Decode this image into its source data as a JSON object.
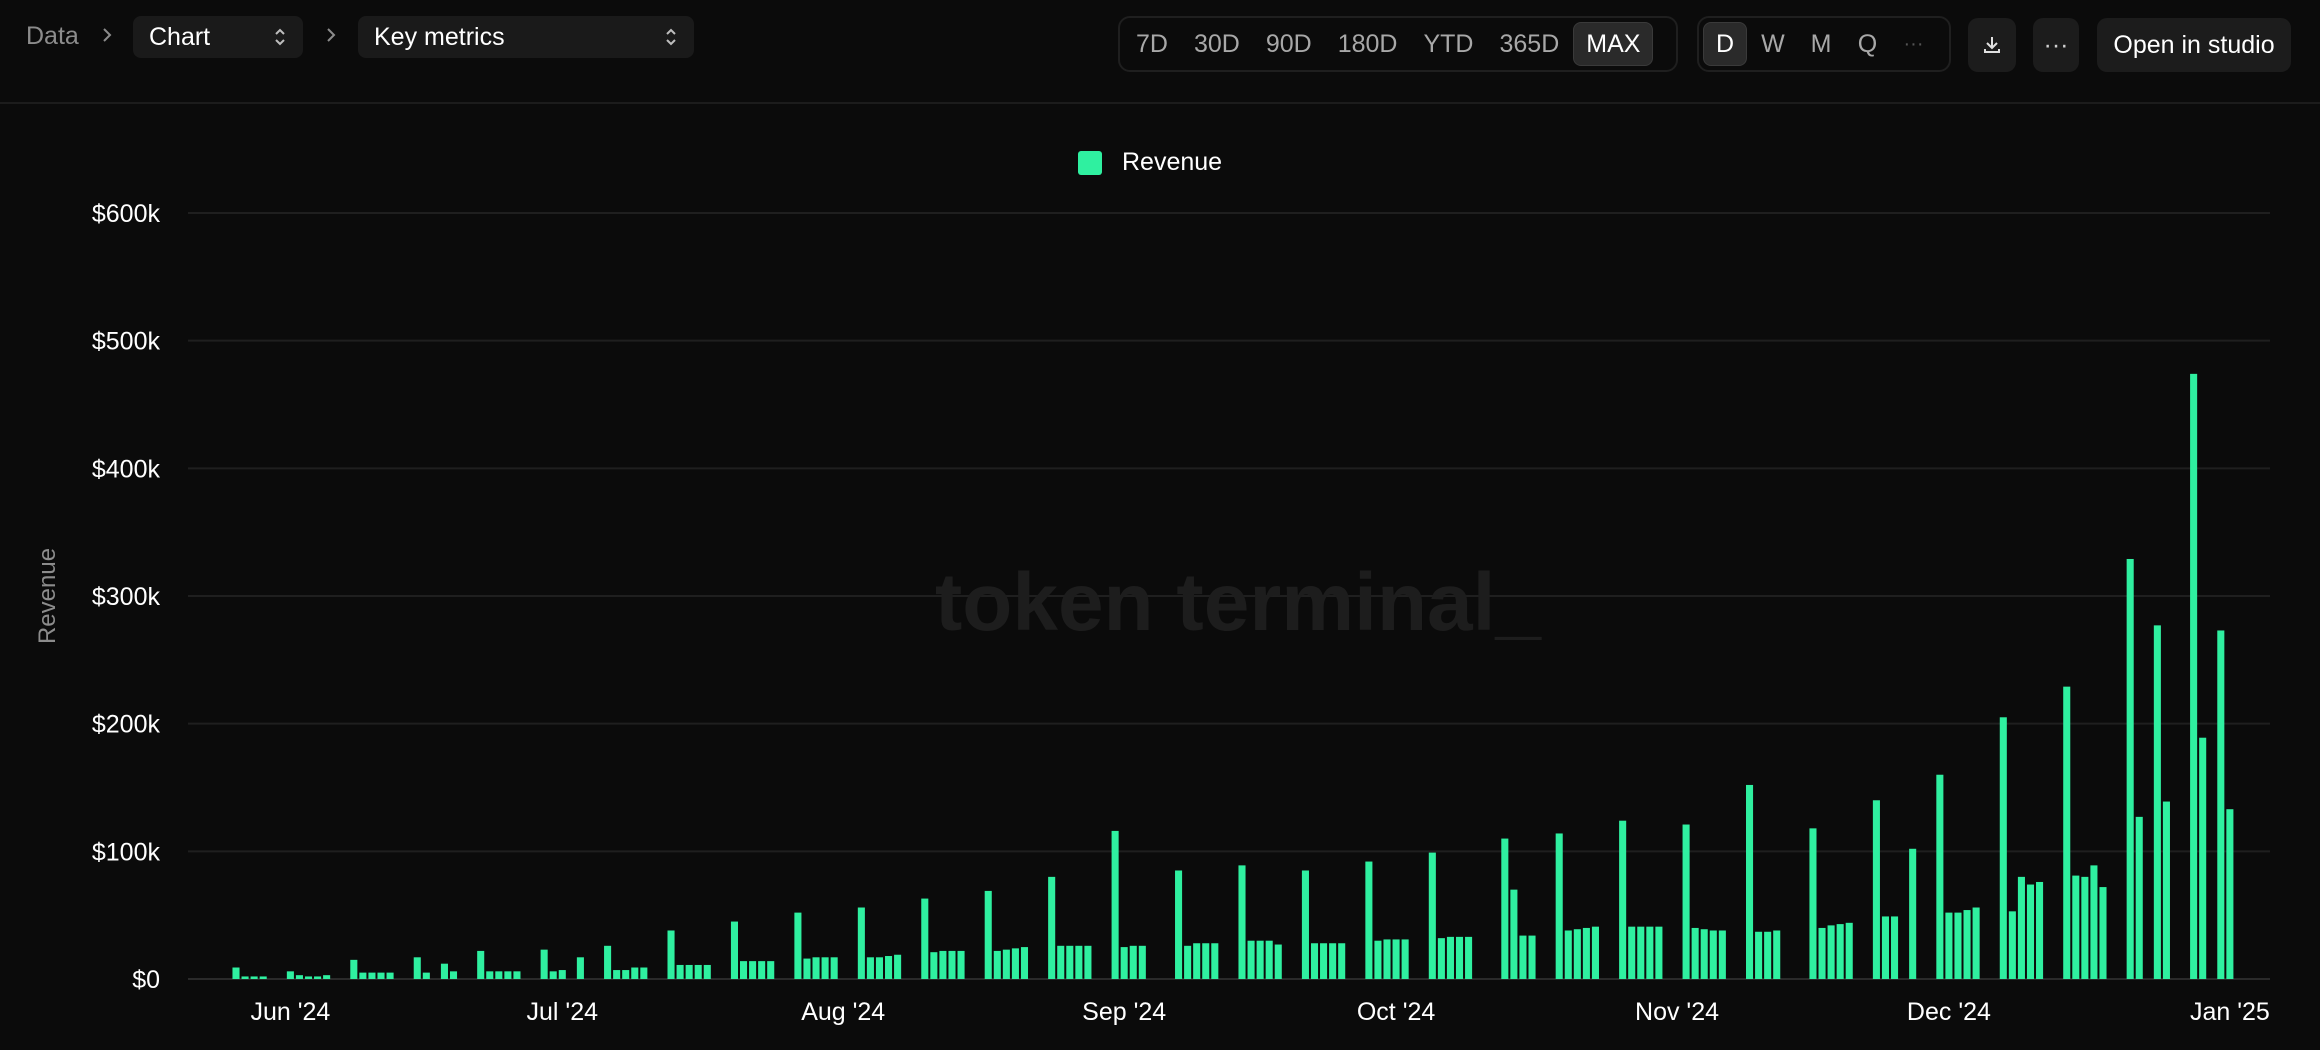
{
  "breadcrumb": {
    "root": "Data",
    "view": "Chart",
    "metric": "Key metrics"
  },
  "toolbar": {
    "ranges": [
      "7D",
      "30D",
      "90D",
      "180D",
      "YTD",
      "365D",
      "MAX"
    ],
    "active_range": "MAX",
    "granularity": [
      "D",
      "W",
      "M",
      "Q"
    ],
    "active_granularity": "D",
    "more_label": "···",
    "download_icon": "download-icon",
    "open_label": "Open in studio"
  },
  "watermark": "token terminal_",
  "colors": {
    "bar": "#2ff0a0",
    "background": "#0b0b0b",
    "grid": "#1f1f1f"
  },
  "chart_data": {
    "type": "bar",
    "series": [
      {
        "name": "Revenue"
      }
    ],
    "ylabel": "Revenue",
    "xlabel": "",
    "ylim": [
      0,
      600000
    ],
    "yticks": [
      0,
      100000,
      200000,
      300000,
      400000,
      500000,
      600000
    ],
    "ytick_labels": [
      "$0",
      "$100k",
      "$200k",
      "$300k",
      "$400k",
      "$500k",
      "$600k"
    ],
    "xticks": [
      "2024-06-01",
      "2024-07-01",
      "2024-08-01",
      "2024-09-01",
      "2024-10-01",
      "2024-11-01",
      "2024-12-01",
      "2025-01-01"
    ],
    "xtick_labels": [
      "Jun '24",
      "Jul '24",
      "Aug '24",
      "Sep '24",
      "Oct '24",
      "Nov '24",
      "Dec '24",
      "Jan '25"
    ],
    "x_range": [
      "2024-05-26",
      "2025-01-03"
    ],
    "legend": "top-center",
    "grid": true,
    "points": [
      [
        "2024-05-26",
        9000
      ],
      [
        "2024-05-27",
        2000
      ],
      [
        "2024-05-28",
        2000
      ],
      [
        "2024-05-29",
        2000
      ],
      [
        "2024-06-01",
        6000
      ],
      [
        "2024-06-02",
        3000
      ],
      [
        "2024-06-03",
        2000
      ],
      [
        "2024-06-04",
        2000
      ],
      [
        "2024-06-05",
        3000
      ],
      [
        "2024-06-08",
        15000
      ],
      [
        "2024-06-09",
        5000
      ],
      [
        "2024-06-10",
        5000
      ],
      [
        "2024-06-11",
        5000
      ],
      [
        "2024-06-12",
        5000
      ],
      [
        "2024-06-15",
        17000
      ],
      [
        "2024-06-16",
        5000
      ],
      [
        "2024-06-18",
        12000
      ],
      [
        "2024-06-19",
        6000
      ],
      [
        "2024-06-22",
        22000
      ],
      [
        "2024-06-23",
        6000
      ],
      [
        "2024-06-24",
        6000
      ],
      [
        "2024-06-25",
        6000
      ],
      [
        "2024-06-26",
        6000
      ],
      [
        "2024-06-29",
        23000
      ],
      [
        "2024-06-30",
        6000
      ],
      [
        "2024-07-01",
        7000
      ],
      [
        "2024-07-03",
        17000
      ],
      [
        "2024-07-06",
        26000
      ],
      [
        "2024-07-07",
        7000
      ],
      [
        "2024-07-08",
        7000
      ],
      [
        "2024-07-09",
        9000
      ],
      [
        "2024-07-10",
        9000
      ],
      [
        "2024-07-13",
        38000
      ],
      [
        "2024-07-14",
        11000
      ],
      [
        "2024-07-15",
        11000
      ],
      [
        "2024-07-16",
        11000
      ],
      [
        "2024-07-17",
        11000
      ],
      [
        "2024-07-20",
        45000
      ],
      [
        "2024-07-21",
        14000
      ],
      [
        "2024-07-22",
        14000
      ],
      [
        "2024-07-23",
        14000
      ],
      [
        "2024-07-24",
        14000
      ],
      [
        "2024-07-27",
        52000
      ],
      [
        "2024-07-28",
        16000
      ],
      [
        "2024-07-29",
        17000
      ],
      [
        "2024-07-30",
        17000
      ],
      [
        "2024-07-31",
        17000
      ],
      [
        "2024-08-03",
        56000
      ],
      [
        "2024-08-04",
        17000
      ],
      [
        "2024-08-05",
        17000
      ],
      [
        "2024-08-06",
        18000
      ],
      [
        "2024-08-07",
        19000
      ],
      [
        "2024-08-10",
        63000
      ],
      [
        "2024-08-11",
        21000
      ],
      [
        "2024-08-12",
        22000
      ],
      [
        "2024-08-13",
        22000
      ],
      [
        "2024-08-14",
        22000
      ],
      [
        "2024-08-17",
        69000
      ],
      [
        "2024-08-18",
        22000
      ],
      [
        "2024-08-19",
        23000
      ],
      [
        "2024-08-20",
        24000
      ],
      [
        "2024-08-21",
        25000
      ],
      [
        "2024-08-24",
        80000
      ],
      [
        "2024-08-25",
        26000
      ],
      [
        "2024-08-26",
        26000
      ],
      [
        "2024-08-27",
        26000
      ],
      [
        "2024-08-28",
        26000
      ],
      [
        "2024-08-31",
        116000
      ],
      [
        "2024-09-01",
        25000
      ],
      [
        "2024-09-02",
        26000
      ],
      [
        "2024-09-03",
        26000
      ],
      [
        "2024-09-07",
        85000
      ],
      [
        "2024-09-08",
        26000
      ],
      [
        "2024-09-09",
        28000
      ],
      [
        "2024-09-10",
        28000
      ],
      [
        "2024-09-11",
        28000
      ],
      [
        "2024-09-14",
        89000
      ],
      [
        "2024-09-15",
        30000
      ],
      [
        "2024-09-16",
        30000
      ],
      [
        "2024-09-17",
        30000
      ],
      [
        "2024-09-18",
        27000
      ],
      [
        "2024-09-21",
        85000
      ],
      [
        "2024-09-22",
        28000
      ],
      [
        "2024-09-23",
        28000
      ],
      [
        "2024-09-24",
        28000
      ],
      [
        "2024-09-25",
        28000
      ],
      [
        "2024-09-28",
        92000
      ],
      [
        "2024-09-29",
        30000
      ],
      [
        "2024-09-30",
        31000
      ],
      [
        "2024-10-01",
        31000
      ],
      [
        "2024-10-02",
        31000
      ],
      [
        "2024-10-05",
        99000
      ],
      [
        "2024-10-06",
        32000
      ],
      [
        "2024-10-07",
        33000
      ],
      [
        "2024-10-08",
        33000
      ],
      [
        "2024-10-09",
        33000
      ],
      [
        "2024-10-13",
        110000
      ],
      [
        "2024-10-14",
        70000
      ],
      [
        "2024-10-15",
        34000
      ],
      [
        "2024-10-16",
        34000
      ],
      [
        "2024-10-19",
        114000
      ],
      [
        "2024-10-20",
        38000
      ],
      [
        "2024-10-21",
        39000
      ],
      [
        "2024-10-22",
        40000
      ],
      [
        "2024-10-23",
        41000
      ],
      [
        "2024-10-26",
        124000
      ],
      [
        "2024-10-27",
        41000
      ],
      [
        "2024-10-28",
        41000
      ],
      [
        "2024-10-29",
        41000
      ],
      [
        "2024-10-30",
        41000
      ],
      [
        "2024-11-02",
        121000
      ],
      [
        "2024-11-03",
        40000
      ],
      [
        "2024-11-04",
        39000
      ],
      [
        "2024-11-05",
        38000
      ],
      [
        "2024-11-06",
        38000
      ],
      [
        "2024-11-09",
        152000
      ],
      [
        "2024-11-10",
        37000
      ],
      [
        "2024-11-11",
        37000
      ],
      [
        "2024-11-12",
        38000
      ],
      [
        "2024-11-16",
        118000
      ],
      [
        "2024-11-17",
        40000
      ],
      [
        "2024-11-18",
        42000
      ],
      [
        "2024-11-19",
        43000
      ],
      [
        "2024-11-20",
        44000
      ],
      [
        "2024-11-23",
        140000
      ],
      [
        "2024-11-24",
        49000
      ],
      [
        "2024-11-25",
        49000
      ],
      [
        "2024-11-27",
        102000
      ],
      [
        "2024-11-30",
        160000
      ],
      [
        "2024-12-01",
        52000
      ],
      [
        "2024-12-02",
        52000
      ],
      [
        "2024-12-03",
        54000
      ],
      [
        "2024-12-04",
        56000
      ],
      [
        "2024-12-07",
        205000
      ],
      [
        "2024-12-08",
        53000
      ],
      [
        "2024-12-09",
        80000
      ],
      [
        "2024-12-10",
        74000
      ],
      [
        "2024-12-11",
        76000
      ],
      [
        "2024-12-14",
        229000
      ],
      [
        "2024-12-15",
        81000
      ],
      [
        "2024-12-16",
        80000
      ],
      [
        "2024-12-17",
        89000
      ],
      [
        "2024-12-18",
        72000
      ],
      [
        "2024-12-21",
        329000
      ],
      [
        "2024-12-22",
        127000
      ],
      [
        "2024-12-24",
        277000
      ],
      [
        "2024-12-25",
        139000
      ],
      [
        "2024-12-28",
        474000
      ],
      [
        "2024-12-29",
        189000
      ],
      [
        "2024-12-31",
        273000
      ],
      [
        "2025-01-01",
        133000
      ]
    ]
  }
}
